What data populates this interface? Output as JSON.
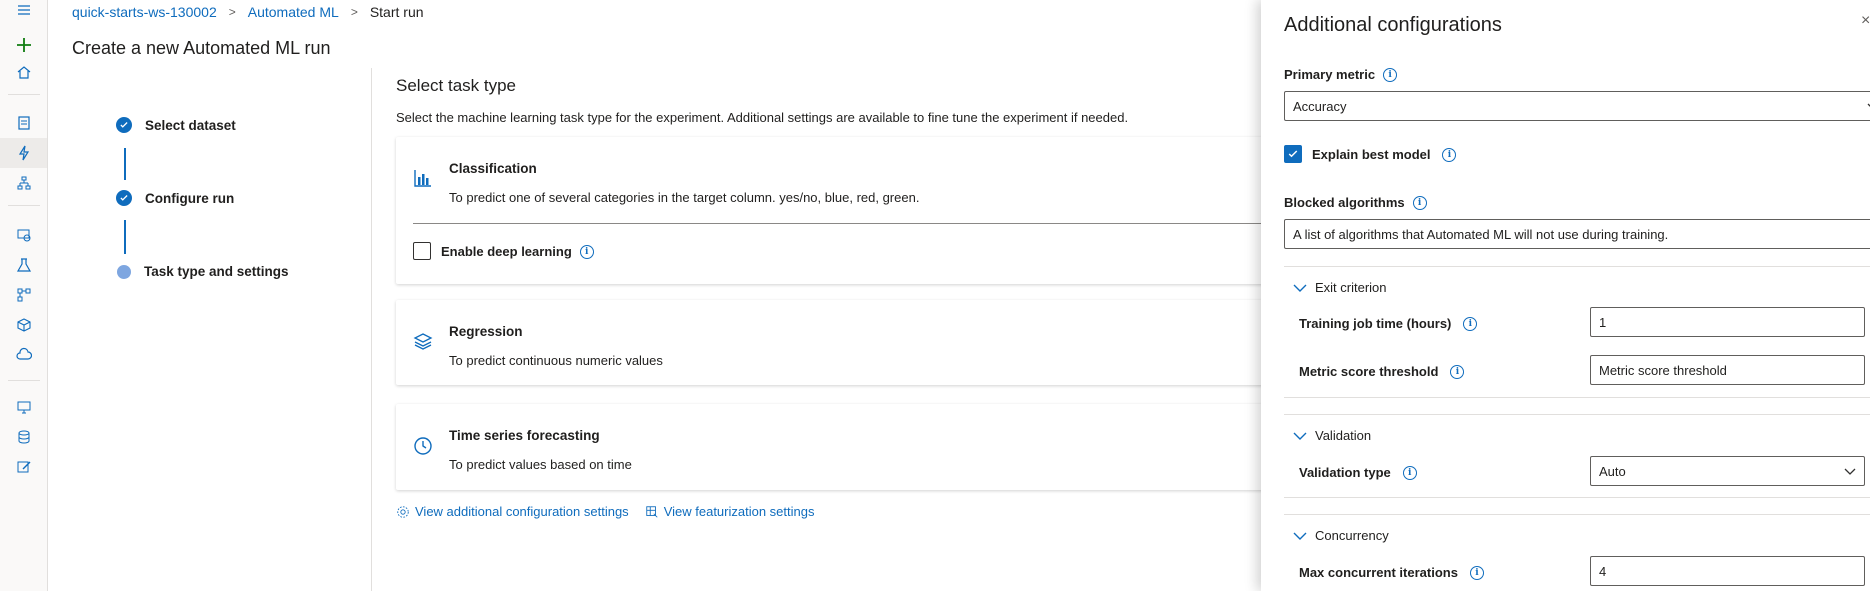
{
  "breadcrumb": {
    "workspace": "quick-starts-ws-130002",
    "automl": "Automated ML",
    "current": "Start run"
  },
  "page_title": "Create a new Automated ML run",
  "steps": [
    {
      "label": "Select dataset",
      "status": "complete"
    },
    {
      "label": "Configure run",
      "status": "complete"
    },
    {
      "label": "Task type and settings",
      "status": "current"
    }
  ],
  "task": {
    "title": "Select task type",
    "description": "Select the machine learning task type for the experiment. Additional settings are available to fine tune the experiment if needed.",
    "cards": [
      {
        "title": "Classification",
        "desc": "To predict one of several categories in the target column. yes/no, blue, red, green.",
        "icon": "bar-chart-icon"
      },
      {
        "title": "Regression",
        "desc": "To predict continuous numeric values",
        "icon": "layers-icon"
      },
      {
        "title": "Time series forecasting",
        "desc": "To predict values based on time",
        "icon": "clock-icon"
      }
    ],
    "deep_learning_label": "Enable deep learning",
    "deep_learning_checked": false
  },
  "links": {
    "additional": "View additional configuration settings",
    "featurization": "View featurization settings"
  },
  "panel": {
    "title": "Additional configurations",
    "primary_metric_label": "Primary metric",
    "primary_metric_value": "Accuracy",
    "explain_label": "Explain best model",
    "explain_checked": true,
    "blocked_label": "Blocked algorithms",
    "blocked_placeholder": "A list of algorithms that Automated ML will not use during training.",
    "exit_section": "Exit criterion",
    "training_time_label": "Training job time (hours)",
    "training_time_value": "1",
    "metric_threshold_label": "Metric score threshold",
    "metric_threshold_placeholder": "Metric score threshold",
    "validation_section": "Validation",
    "validation_type_label": "Validation type",
    "validation_type_value": "Auto",
    "concurrency_section": "Concurrency",
    "max_iter_label": "Max concurrent iterations",
    "max_iter_value": "4"
  },
  "colors": {
    "accent": "#0f6cbd",
    "pending_step": "#7ea6e0",
    "new_button": "#107c10"
  }
}
